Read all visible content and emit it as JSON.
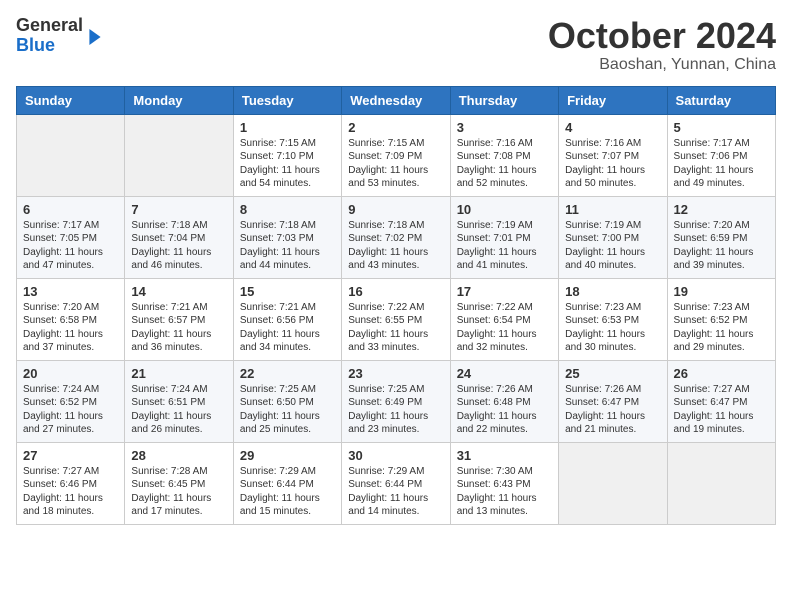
{
  "header": {
    "logo_general": "General",
    "logo_blue": "Blue",
    "title": "October 2024",
    "location": "Baoshan, Yunnan, China"
  },
  "weekdays": [
    "Sunday",
    "Monday",
    "Tuesday",
    "Wednesday",
    "Thursday",
    "Friday",
    "Saturday"
  ],
  "weeks": [
    [
      {
        "day": "",
        "info": ""
      },
      {
        "day": "",
        "info": ""
      },
      {
        "day": "1",
        "info": "Sunrise: 7:15 AM\nSunset: 7:10 PM\nDaylight: 11 hours and 54 minutes."
      },
      {
        "day": "2",
        "info": "Sunrise: 7:15 AM\nSunset: 7:09 PM\nDaylight: 11 hours and 53 minutes."
      },
      {
        "day": "3",
        "info": "Sunrise: 7:16 AM\nSunset: 7:08 PM\nDaylight: 11 hours and 52 minutes."
      },
      {
        "day": "4",
        "info": "Sunrise: 7:16 AM\nSunset: 7:07 PM\nDaylight: 11 hours and 50 minutes."
      },
      {
        "day": "5",
        "info": "Sunrise: 7:17 AM\nSunset: 7:06 PM\nDaylight: 11 hours and 49 minutes."
      }
    ],
    [
      {
        "day": "6",
        "info": "Sunrise: 7:17 AM\nSunset: 7:05 PM\nDaylight: 11 hours and 47 minutes."
      },
      {
        "day": "7",
        "info": "Sunrise: 7:18 AM\nSunset: 7:04 PM\nDaylight: 11 hours and 46 minutes."
      },
      {
        "day": "8",
        "info": "Sunrise: 7:18 AM\nSunset: 7:03 PM\nDaylight: 11 hours and 44 minutes."
      },
      {
        "day": "9",
        "info": "Sunrise: 7:18 AM\nSunset: 7:02 PM\nDaylight: 11 hours and 43 minutes."
      },
      {
        "day": "10",
        "info": "Sunrise: 7:19 AM\nSunset: 7:01 PM\nDaylight: 11 hours and 41 minutes."
      },
      {
        "day": "11",
        "info": "Sunrise: 7:19 AM\nSunset: 7:00 PM\nDaylight: 11 hours and 40 minutes."
      },
      {
        "day": "12",
        "info": "Sunrise: 7:20 AM\nSunset: 6:59 PM\nDaylight: 11 hours and 39 minutes."
      }
    ],
    [
      {
        "day": "13",
        "info": "Sunrise: 7:20 AM\nSunset: 6:58 PM\nDaylight: 11 hours and 37 minutes."
      },
      {
        "day": "14",
        "info": "Sunrise: 7:21 AM\nSunset: 6:57 PM\nDaylight: 11 hours and 36 minutes."
      },
      {
        "day": "15",
        "info": "Sunrise: 7:21 AM\nSunset: 6:56 PM\nDaylight: 11 hours and 34 minutes."
      },
      {
        "day": "16",
        "info": "Sunrise: 7:22 AM\nSunset: 6:55 PM\nDaylight: 11 hours and 33 minutes."
      },
      {
        "day": "17",
        "info": "Sunrise: 7:22 AM\nSunset: 6:54 PM\nDaylight: 11 hours and 32 minutes."
      },
      {
        "day": "18",
        "info": "Sunrise: 7:23 AM\nSunset: 6:53 PM\nDaylight: 11 hours and 30 minutes."
      },
      {
        "day": "19",
        "info": "Sunrise: 7:23 AM\nSunset: 6:52 PM\nDaylight: 11 hours and 29 minutes."
      }
    ],
    [
      {
        "day": "20",
        "info": "Sunrise: 7:24 AM\nSunset: 6:52 PM\nDaylight: 11 hours and 27 minutes."
      },
      {
        "day": "21",
        "info": "Sunrise: 7:24 AM\nSunset: 6:51 PM\nDaylight: 11 hours and 26 minutes."
      },
      {
        "day": "22",
        "info": "Sunrise: 7:25 AM\nSunset: 6:50 PM\nDaylight: 11 hours and 25 minutes."
      },
      {
        "day": "23",
        "info": "Sunrise: 7:25 AM\nSunset: 6:49 PM\nDaylight: 11 hours and 23 minutes."
      },
      {
        "day": "24",
        "info": "Sunrise: 7:26 AM\nSunset: 6:48 PM\nDaylight: 11 hours and 22 minutes."
      },
      {
        "day": "25",
        "info": "Sunrise: 7:26 AM\nSunset: 6:47 PM\nDaylight: 11 hours and 21 minutes."
      },
      {
        "day": "26",
        "info": "Sunrise: 7:27 AM\nSunset: 6:47 PM\nDaylight: 11 hours and 19 minutes."
      }
    ],
    [
      {
        "day": "27",
        "info": "Sunrise: 7:27 AM\nSunset: 6:46 PM\nDaylight: 11 hours and 18 minutes."
      },
      {
        "day": "28",
        "info": "Sunrise: 7:28 AM\nSunset: 6:45 PM\nDaylight: 11 hours and 17 minutes."
      },
      {
        "day": "29",
        "info": "Sunrise: 7:29 AM\nSunset: 6:44 PM\nDaylight: 11 hours and 15 minutes."
      },
      {
        "day": "30",
        "info": "Sunrise: 7:29 AM\nSunset: 6:44 PM\nDaylight: 11 hours and 14 minutes."
      },
      {
        "day": "31",
        "info": "Sunrise: 7:30 AM\nSunset: 6:43 PM\nDaylight: 11 hours and 13 minutes."
      },
      {
        "day": "",
        "info": ""
      },
      {
        "day": "",
        "info": ""
      }
    ]
  ]
}
